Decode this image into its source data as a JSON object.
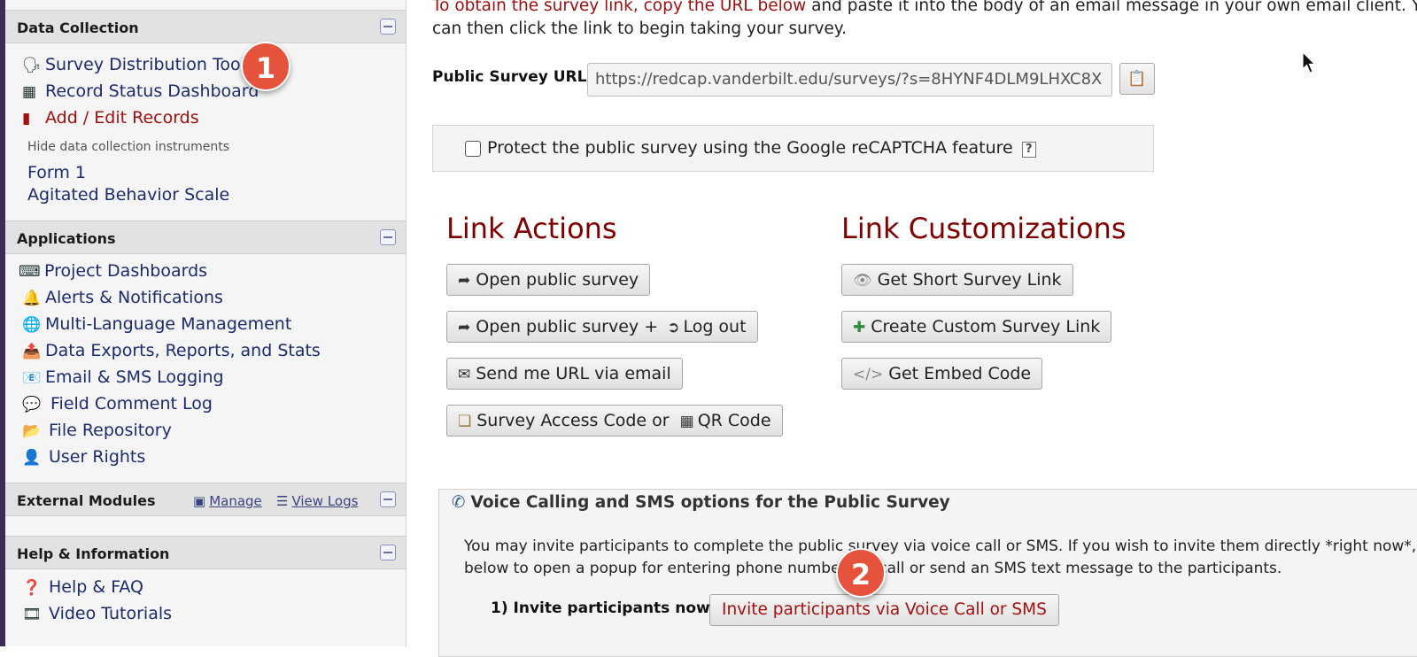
{
  "sidebar": {
    "data_collection": {
      "title": "Data Collection",
      "items": [
        {
          "label": "Survey Distribution Tools",
          "icon": "survey-distribution-icon"
        },
        {
          "label": "Record Status Dashboard",
          "icon": "table-grid-icon"
        },
        {
          "label": "Add / Edit Records",
          "icon": "document-icon"
        }
      ],
      "hide_instruments_label": "Hide data collection instruments",
      "instruments": [
        "Form 1",
        "Agitated Behavior Scale"
      ]
    },
    "applications": {
      "title": "Applications",
      "items": [
        {
          "label": "Project Dashboards",
          "icon": "dashboard-icon"
        },
        {
          "label": "Alerts & Notifications",
          "icon": "bell-icon"
        },
        {
          "label": "Multi-Language Management",
          "icon": "globe-icon"
        },
        {
          "label": "Data Exports, Reports, and Stats",
          "icon": "file-export-icon"
        },
        {
          "label": "Email & SMS Logging",
          "icon": "mail-log-icon"
        },
        {
          "label": "Field Comment Log",
          "icon": "comments-icon"
        },
        {
          "label": "File Repository",
          "icon": "folder-open-icon"
        },
        {
          "label": "User Rights",
          "icon": "user-icon"
        }
      ]
    },
    "external_modules": {
      "title": "External Modules",
      "manage_label": "Manage",
      "view_logs_label": "View Logs"
    },
    "help": {
      "title": "Help & Information",
      "items": [
        {
          "label": "Help & FAQ",
          "icon": "question-circle-icon"
        },
        {
          "label": "Video Tutorials",
          "icon": "film-icon"
        }
      ]
    }
  },
  "badges": {
    "one": "1",
    "two": "2"
  },
  "main": {
    "intro_red": "To obtain the survey link, copy the URL below",
    "intro_rest_line1": " and paste it into the body of an email message in your own email client. Your e",
    "intro_line2": "can then click the link to begin taking your survey.",
    "url_label": "Public Survey URL:",
    "url_value": "https://redcap.vanderbilt.edu/surveys/?s=8HYNF4DLM9LHXC8X",
    "captcha_label": "Protect the public survey using the Google reCAPTCHA feature",
    "captcha_help": "?",
    "link_actions_title": "Link Actions",
    "link_customizations_title": "Link Customizations",
    "actions": {
      "open_public": "Open public survey",
      "open_public_logout_a": "Open public survey +",
      "open_public_logout_b": "Log out",
      "send_url": "Send me URL via email",
      "access_code_a": "Survey Access Code or",
      "access_code_b": "QR Code"
    },
    "customizations": {
      "short_link": "Get Short Survey Link",
      "custom_link": "Create Custom Survey Link",
      "embed_code": "Get Embed Code"
    },
    "voice": {
      "title": "Voice Calling and SMS options for the Public Survey",
      "text_line1": "You may invite participants to complete the public survey via voice call or SMS. If you wish to invite them directly *right now*, click",
      "text_line2": "below to open a popup for entering phone numbers to call or send an SMS text message to the participants.",
      "invite_label": "1) Invite participants now:",
      "invite_button": "Invite participants via Voice Call or SMS"
    }
  }
}
